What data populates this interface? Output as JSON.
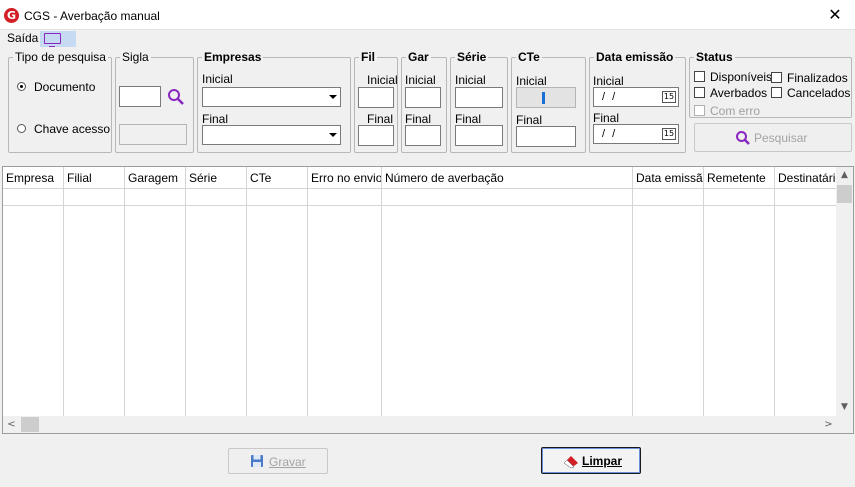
{
  "window": {
    "title": "CGS -  Averbação manual",
    "logo_letter": "G",
    "close_glyph": "✕"
  },
  "menu": {
    "saida": "Saída",
    "monitor_icon": "monitor-icon"
  },
  "filters": {
    "tipo_pesquisa": {
      "legend": "Tipo de pesquisa",
      "options": [
        "Documento",
        "Chave acesso"
      ],
      "selected": "Documento"
    },
    "sigla": {
      "legend": "Sigla",
      "search_icon": "search-icon"
    },
    "empresas": {
      "legend": "Empresas",
      "inicial": "Inicial",
      "final": "Final"
    },
    "fil": {
      "legend": "Fil",
      "inicial": "Inicial",
      "final": "Final"
    },
    "gar": {
      "legend": "Gar",
      "inicial": "Inicial",
      "final": "Final"
    },
    "serie": {
      "legend": "Série",
      "inicial": "Inicial",
      "final": "Final"
    },
    "cte": {
      "legend": "CTe",
      "inicial": "Inicial",
      "final": "Final"
    },
    "data_emissao": {
      "legend": "Data emissão",
      "inicial": "Inicial",
      "final": "Final",
      "inicial_value": "/ /",
      "final_value": "/ /",
      "calendar_glyph": "15"
    },
    "status": {
      "legend": "Status",
      "disponiveis": "Disponíveis",
      "finalizados": "Finalizados",
      "averbados": "Averbados",
      "cancelados": "Cancelados",
      "com_erro": "Com erro"
    },
    "pesquisar_label": "Pesquisar"
  },
  "table": {
    "columns": [
      "Empresa",
      "Filial",
      "Garagem",
      "Série",
      "CTe",
      "Erro no envio",
      "Número de averbação",
      "Data emissão",
      "Remetente",
      "Destinatário"
    ],
    "rows": []
  },
  "footer": {
    "gravar_label": "Gravar",
    "limpar_label": "Limpar"
  },
  "colors": {
    "accent_purple": "#8a26c0",
    "logo_red": "#d21f26",
    "limpar_icon_red": "#d21f26",
    "gravar_icon_blue": "#4a7ac8"
  }
}
